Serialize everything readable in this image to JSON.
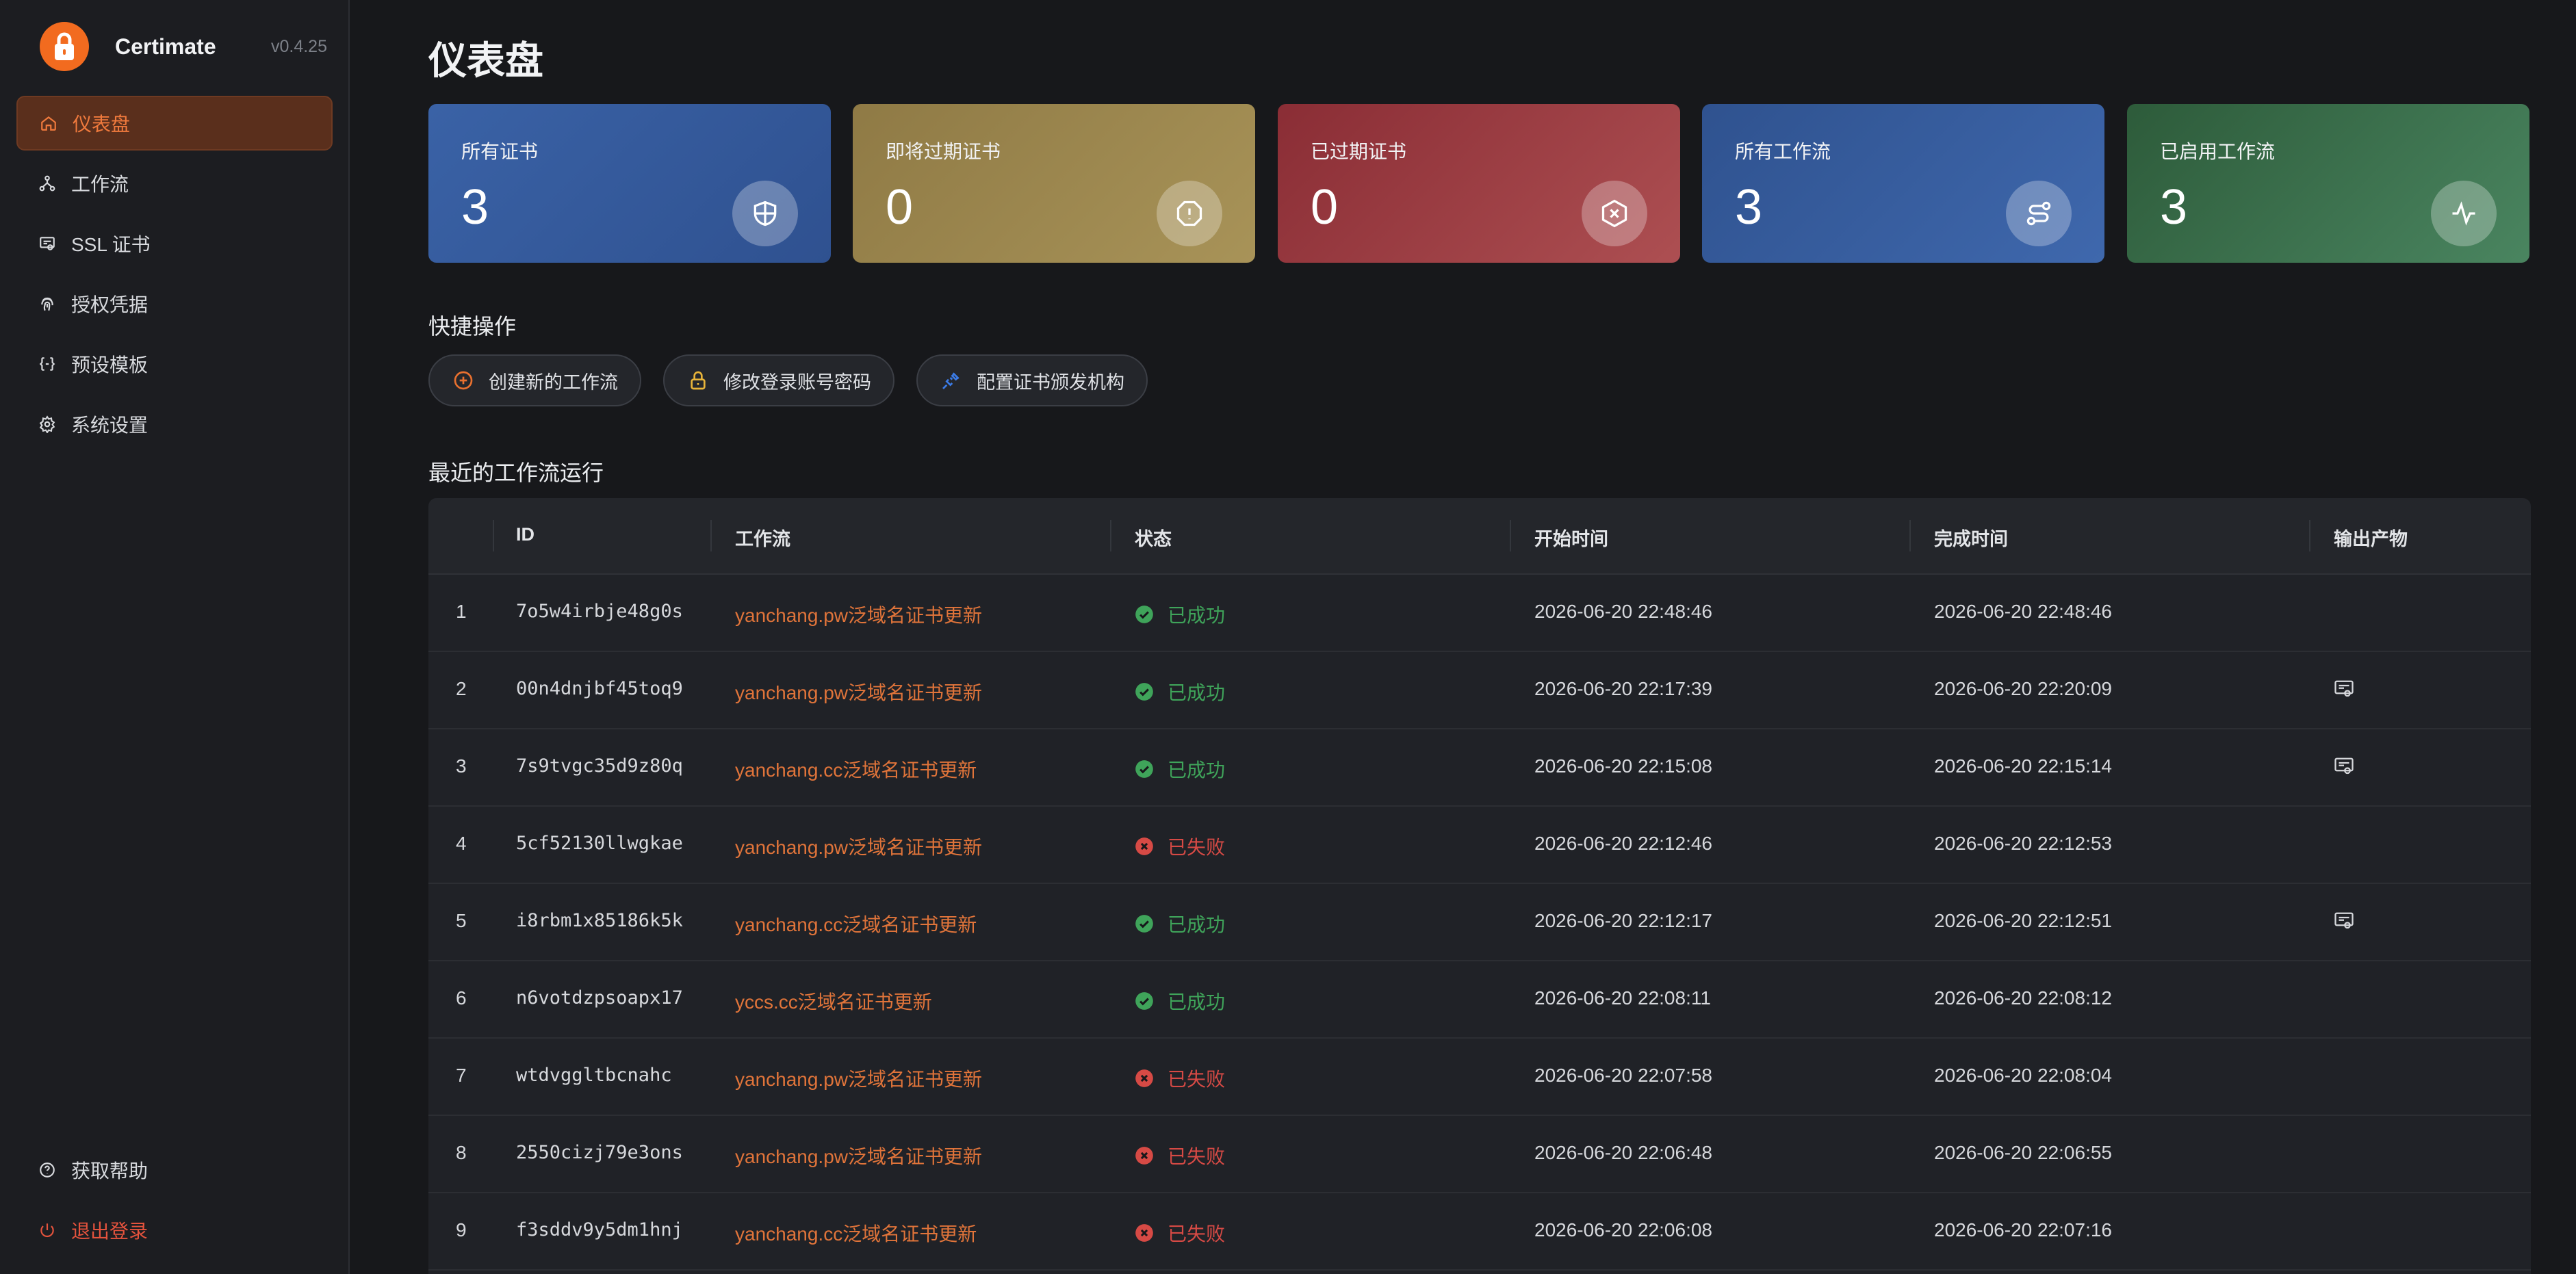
{
  "app": {
    "name": "Certimate",
    "version": "v0.4.25"
  },
  "sidebar": {
    "items": [
      {
        "label": "仪表盘",
        "icon": "home-icon"
      },
      {
        "label": "工作流",
        "icon": "workflow-icon"
      },
      {
        "label": "SSL 证书",
        "icon": "certificate-icon"
      },
      {
        "label": "授权凭据",
        "icon": "fingerprint-icon"
      },
      {
        "label": "预设模板",
        "icon": "braces-icon"
      },
      {
        "label": "系统设置",
        "icon": "gear-icon"
      }
    ],
    "bottom": [
      {
        "label": "获取帮助",
        "icon": "help-icon"
      },
      {
        "label": "退出登录",
        "icon": "power-icon"
      }
    ]
  },
  "page": {
    "title": "仪表盘"
  },
  "stats": [
    {
      "label": "所有证书",
      "value": "3",
      "icon": "shield-icon"
    },
    {
      "label": "即将过期证书",
      "value": "0",
      "icon": "alert-icon"
    },
    {
      "label": "已过期证书",
      "value": "0",
      "icon": "x-hexagon-icon"
    },
    {
      "label": "所有工作流",
      "value": "3",
      "icon": "route-icon"
    },
    {
      "label": "已启用工作流",
      "value": "3",
      "icon": "activity-icon"
    }
  ],
  "quick": {
    "title": "快捷操作",
    "actions": [
      {
        "label": "创建新的工作流",
        "icon": "plus-circle-icon",
        "color": "#e8702f"
      },
      {
        "label": "修改登录账号密码",
        "icon": "lock-icon",
        "color": "#e8b43a"
      },
      {
        "label": "配置证书颁发机构",
        "icon": "plug-icon",
        "color": "#3b7be6"
      }
    ]
  },
  "runs": {
    "title": "最近的工作流运行",
    "columns": [
      "ID",
      "工作流",
      "状态",
      "开始时间",
      "完成时间",
      "输出产物"
    ],
    "rows": [
      {
        "n": "1",
        "id": "7o5w4irbje48g0s",
        "workflow": "yanchang.pw泛域名证书更新",
        "status": "已成功",
        "ok": true,
        "start": "2026-06-20 22:48:46",
        "end": "2026-06-20 22:48:46",
        "artifact": false
      },
      {
        "n": "2",
        "id": "00n4dnjbf45toq9",
        "workflow": "yanchang.pw泛域名证书更新",
        "status": "已成功",
        "ok": true,
        "start": "2026-06-20 22:17:39",
        "end": "2026-06-20 22:20:09",
        "artifact": true
      },
      {
        "n": "3",
        "id": "7s9tvgc35d9z80q",
        "workflow": "yanchang.cc泛域名证书更新",
        "status": "已成功",
        "ok": true,
        "start": "2026-06-20 22:15:08",
        "end": "2026-06-20 22:15:14",
        "artifact": true
      },
      {
        "n": "4",
        "id": "5cf52130llwgkae",
        "workflow": "yanchang.pw泛域名证书更新",
        "status": "已失败",
        "ok": false,
        "start": "2026-06-20 22:12:46",
        "end": "2026-06-20 22:12:53",
        "artifact": false
      },
      {
        "n": "5",
        "id": "i8rbm1x85186k5k",
        "workflow": "yanchang.cc泛域名证书更新",
        "status": "已成功",
        "ok": true,
        "start": "2026-06-20 22:12:17",
        "end": "2026-06-20 22:12:51",
        "artifact": true
      },
      {
        "n": "6",
        "id": "n6votdzpsoapx17",
        "workflow": "yccs.cc泛域名证书更新",
        "status": "已成功",
        "ok": true,
        "start": "2026-06-20 22:08:11",
        "end": "2026-06-20 22:08:12",
        "artifact": false
      },
      {
        "n": "7",
        "id": "wtdvggltbcnahc",
        "workflow": "yanchang.pw泛域名证书更新",
        "status": "已失败",
        "ok": false,
        "start": "2026-06-20 22:07:58",
        "end": "2026-06-20 22:08:04",
        "artifact": false
      },
      {
        "n": "8",
        "id": "2550cizj79e3ons",
        "workflow": "yanchang.pw泛域名证书更新",
        "status": "已失败",
        "ok": false,
        "start": "2026-06-20 22:06:48",
        "end": "2026-06-20 22:06:55",
        "artifact": false
      },
      {
        "n": "9",
        "id": "f3sddv9y5dm1hnj",
        "workflow": "yanchang.cc泛域名证书更新",
        "status": "已失败",
        "ok": false,
        "start": "2026-06-20 22:06:08",
        "end": "2026-06-20 22:07:16",
        "artifact": false
      }
    ]
  }
}
